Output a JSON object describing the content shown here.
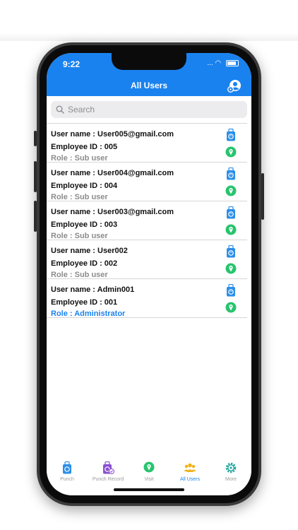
{
  "status_bar": {
    "time": "9:22",
    "right": "... ◠"
  },
  "nav": {
    "title": "All Users",
    "account_icon": "account-settings-icon"
  },
  "search": {
    "placeholder": "Search"
  },
  "users": [
    {
      "username": "User name : User005@gmail.com",
      "employee_id": "Employee ID : 005",
      "role": "Role : Sub user",
      "is_admin": false
    },
    {
      "username": "User name : User004@gmail.com",
      "employee_id": "Employee ID : 004",
      "role": "Role : Sub user",
      "is_admin": false
    },
    {
      "username": "User name : User003@gmail.com",
      "employee_id": "Employee ID : 003",
      "role": "Role : Sub user",
      "is_admin": false
    },
    {
      "username": "User name : User002",
      "employee_id": "Employee ID : 002",
      "role": "Role : Sub user",
      "is_admin": false
    },
    {
      "username": "User name : Admin001",
      "employee_id": "Employee ID : 001",
      "role": "Role : Administrator",
      "is_admin": true
    }
  ],
  "tabs": [
    {
      "label": "Punch",
      "icon": "punch-icon",
      "active": false
    },
    {
      "label": "Punch Record",
      "icon": "punch-record-icon",
      "active": false
    },
    {
      "label": "Visit",
      "icon": "visit-icon",
      "active": false
    },
    {
      "label": "All Users",
      "icon": "all-users-icon",
      "active": true
    },
    {
      "label": "More",
      "icon": "more-gear-icon",
      "active": false
    }
  ],
  "colors": {
    "primary": "#1a82ef",
    "punch_blue": "#2d8fe8",
    "visit_green": "#27c46e",
    "record_purple": "#8a4fd0",
    "users_gold": "#f0b21a",
    "more_teal": "#27a9a0",
    "role_gray": "#8c8c8c"
  }
}
